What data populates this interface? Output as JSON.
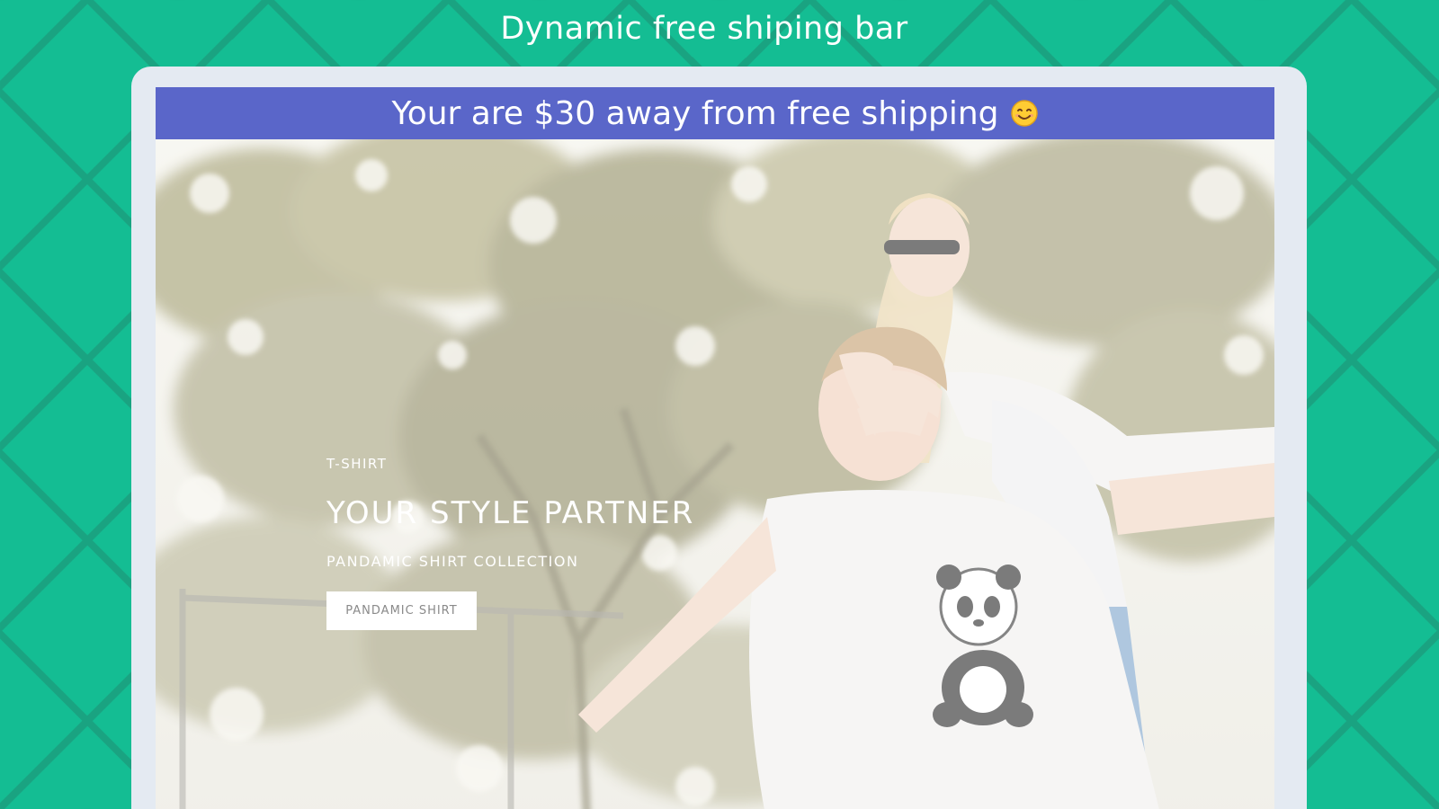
{
  "page": {
    "heading": "Dynamic free shiping bar"
  },
  "shipping_bar": {
    "message": "Your are $30 away from free shipping",
    "emoji_icon": "smiling-face-emoji",
    "background_color": "#5a66c9",
    "text_color": "#ffffff"
  },
  "hero": {
    "eyebrow": "T-SHIRT",
    "title": "YOUR STYLE PARTNER",
    "subtitle": "PANDAMIC SHIRT COLLECTION",
    "button_label": "PANDAMIC SHIRT"
  },
  "colors": {
    "background": "#14bd93",
    "background_lines": "#1aa381",
    "device_frame": "#e4eaf2"
  }
}
